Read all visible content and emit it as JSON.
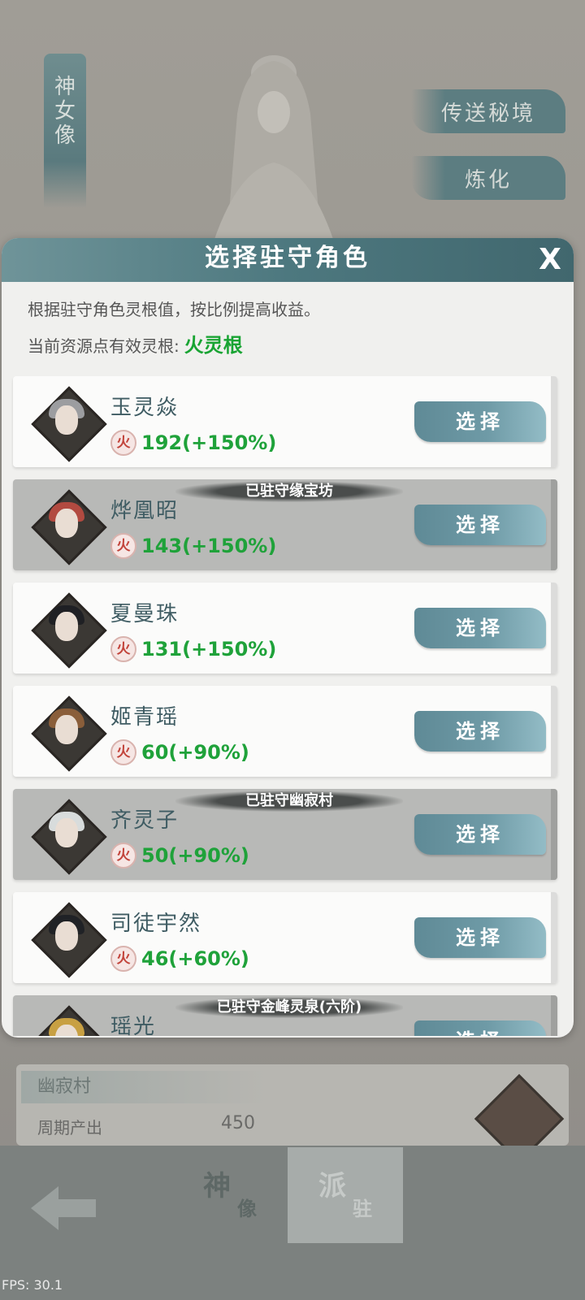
{
  "background": {
    "banner_chars": [
      "神",
      "女",
      "像"
    ],
    "side_buttons": [
      "传送秘境",
      "炼化"
    ],
    "card_title": "幽寂村",
    "card_row_label": "周期产出",
    "card_row_value": "450"
  },
  "bottom_nav": {
    "tab1_big": "神",
    "tab1_small": "像",
    "tab2_big": "派",
    "tab2_small": "驻"
  },
  "fps": "FPS: 30.1",
  "modal": {
    "title": "选择驻守角色",
    "close": "X",
    "desc": "根据驻守角色灵根值，按比例提高收益。",
    "current_label": "当前资源点有效灵根:",
    "current_value": "火灵根",
    "select_label": "选择",
    "fire_glyph": "火"
  },
  "characters": [
    {
      "name": "玉灵焱",
      "value": "192(+150%)",
      "stationed": "",
      "hair": "#9c9da0"
    },
    {
      "name": "烨凰昭",
      "value": "143(+150%)",
      "stationed": "已驻守缘宝坊",
      "hair": "#b24a40"
    },
    {
      "name": "夏曼珠",
      "value": "131(+150%)",
      "stationed": "",
      "hair": "#1f2024"
    },
    {
      "name": "姬青瑶",
      "value": "60(+90%)",
      "stationed": "",
      "hair": "#8a5e3a"
    },
    {
      "name": "齐灵子",
      "value": "50(+90%)",
      "stationed": "已驻守幽寂村",
      "hair": "#d8dcdc"
    },
    {
      "name": "司徒宇然",
      "value": "46(+60%)",
      "stationed": "",
      "hair": "#202226"
    },
    {
      "name": "瑶光",
      "value": "",
      "stationed": "已驻守金峰灵泉(六阶)",
      "hair": "#c8a043"
    }
  ],
  "colors": {
    "header": "#4d787f",
    "value_green": "#1fa23a",
    "name_text": "#3f5c63",
    "select_btn": "#6e9aa6"
  }
}
